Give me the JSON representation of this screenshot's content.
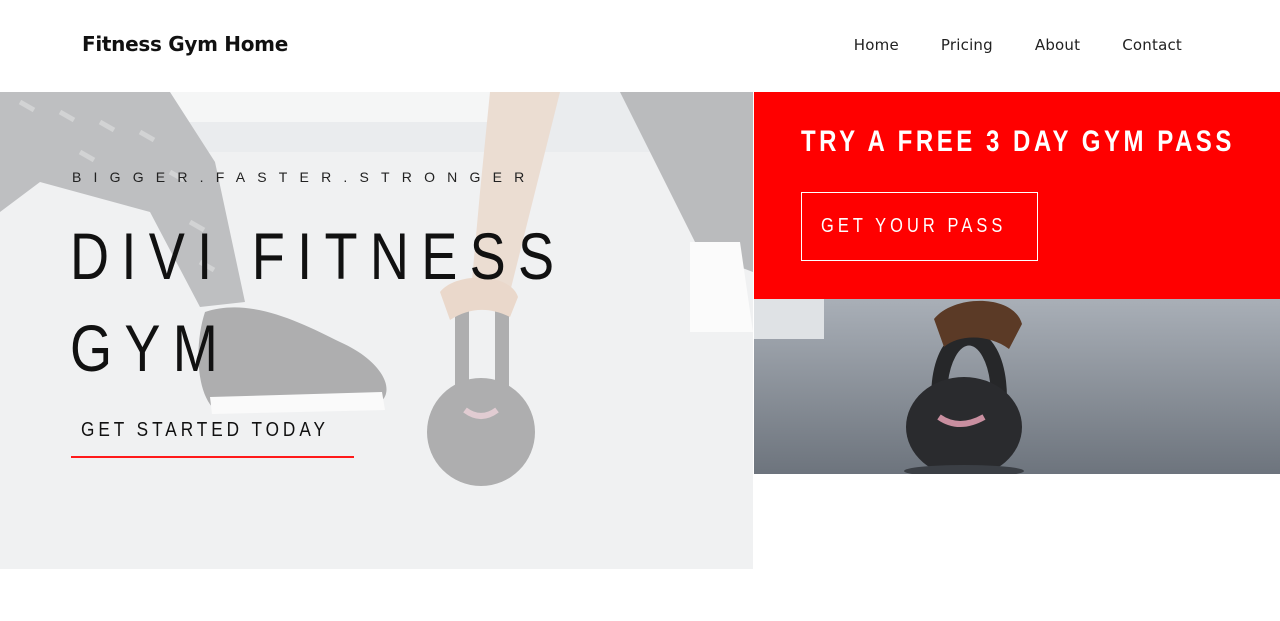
{
  "header": {
    "logo": "Fitness Gym Home",
    "nav": [
      "Home",
      "Pricing",
      "About",
      "Contact"
    ]
  },
  "hero": {
    "tagline": "BIGGER.FASTER.STRONGER",
    "title_line1": "DIVI FITNESS",
    "title_line2": "GYM",
    "cta": "GET STARTED TODAY",
    "image_icon": "kettlebell-workout-image"
  },
  "promo": {
    "title": "TRY A FREE 3 DAY GYM PASS",
    "button": "GET YOUR PASS",
    "image_icon": "kettlebell-closeup-image"
  },
  "colors": {
    "accent": "#ff0000",
    "underline": "#ff1a1a",
    "text": "#111111",
    "background": "#ffffff"
  }
}
